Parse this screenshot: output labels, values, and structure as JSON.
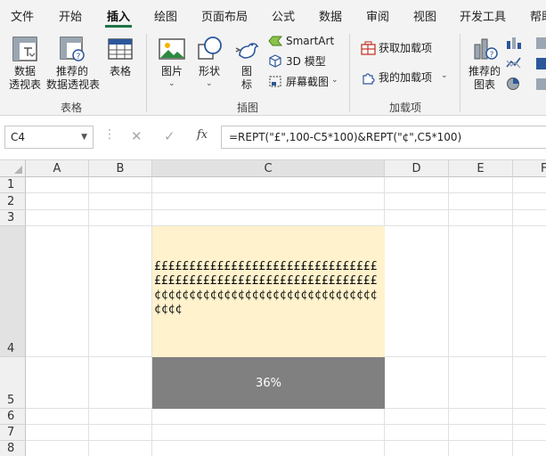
{
  "menu": {
    "items": [
      "文件",
      "开始",
      "插入",
      "绘图",
      "页面布局",
      "公式",
      "数据",
      "审阅",
      "视图",
      "开发工具",
      "帮助"
    ],
    "active": "插入"
  },
  "ribbon": {
    "tables": {
      "pivot_line1": "数据",
      "pivot_line2": "透视表",
      "rec_pivot_line1": "推荐的",
      "rec_pivot_line2": "数据透视表",
      "table": "表格",
      "group": "表格"
    },
    "illustrations": {
      "pictures": "图片",
      "shapes": "形状",
      "icons_line1": "图",
      "icons_line2": "标",
      "smartart": "SmartArt",
      "model3d": "3D 模型",
      "screenshot": "屏幕截图",
      "group": "插图"
    },
    "addins": {
      "get": "获取加载项",
      "mine": "我的加载项",
      "group": "加载项"
    },
    "charts": {
      "rec_line1": "推荐的",
      "rec_line2": "图表"
    }
  },
  "formula_bar": {
    "name_box": "C4",
    "formula": "=REPT(\"£\",100-C5*100)&REPT(\"¢\",C5*100)",
    "fx": "fx"
  },
  "sheet": {
    "columns": [
      "A",
      "B",
      "C",
      "D",
      "E",
      "F"
    ],
    "rows": [
      "1",
      "2",
      "3",
      "4",
      "5",
      "6",
      "7",
      "8"
    ],
    "c4_value": "££££££££££££££££££££££££££££££££££££££££££££££££££££££££££££££££¢¢¢¢¢¢¢¢¢¢¢¢¢¢¢¢¢¢¢¢¢¢¢¢¢¢¢¢¢¢¢¢¢¢¢¢",
    "c5_value": "36%"
  },
  "colors": {
    "accent": "#217346",
    "c4_fill": "#fff2cc",
    "c5_fill": "#808080"
  }
}
